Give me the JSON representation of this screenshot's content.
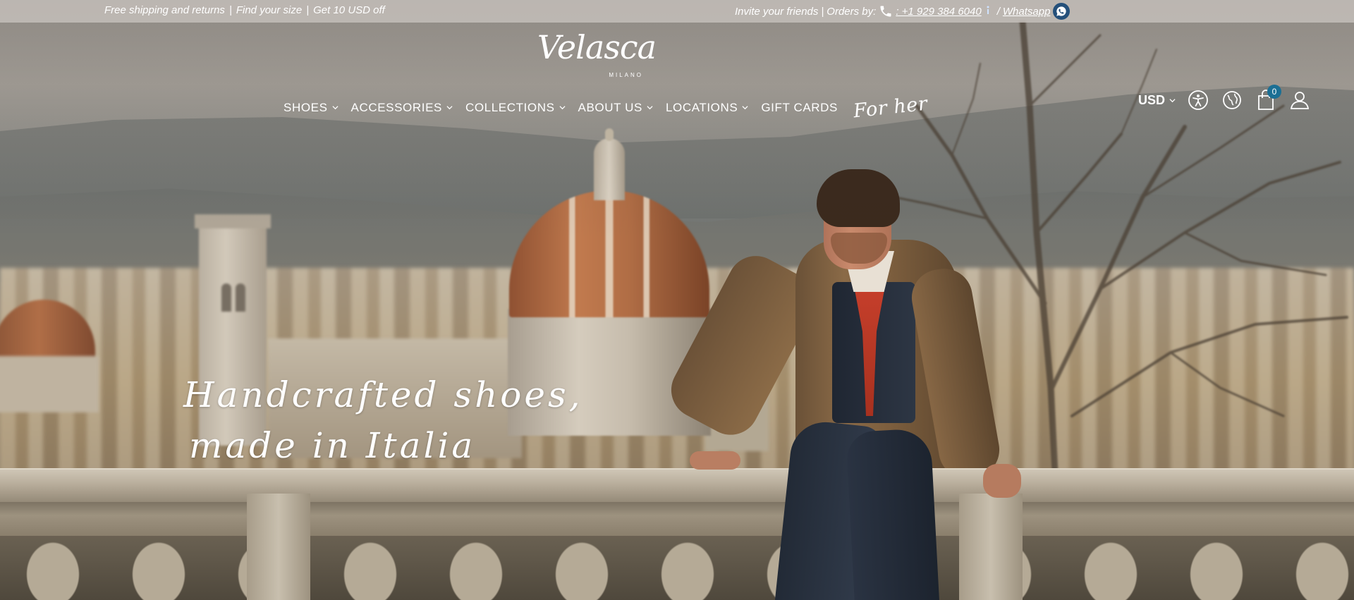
{
  "topbar": {
    "left": [
      {
        "label": "Free shipping and returns"
      },
      {
        "label": "Find your size"
      },
      {
        "label": "Get 10 USD off"
      }
    ],
    "invite": "Invite your friends",
    "orders_label": "Orders by:",
    "phone": ": +1 929 384 6040",
    "whatsapp": "Whatsapp",
    "separator": "|",
    "slash": "/"
  },
  "logo": {
    "script": "Velasca",
    "sub": "MILANO"
  },
  "nav": {
    "items": [
      {
        "label": "SHOES"
      },
      {
        "label": "ACCESSORIES"
      },
      {
        "label": "COLLECTIONS"
      },
      {
        "label": "ABOUT US"
      },
      {
        "label": "LOCATIONS"
      },
      {
        "label": "GIFT CARDS"
      }
    ],
    "for_her": "For her"
  },
  "header_tools": {
    "currency": "USD",
    "cart_count": "0",
    "icons": [
      "accessibility-icon",
      "globe-icon",
      "cart-icon",
      "user-icon"
    ]
  },
  "hero": {
    "line1": "Handcrafted shoes,",
    "line2": "made in Italia"
  },
  "colors": {
    "topbar_bg": "#c8c3be",
    "accent_badge": "#1b6f94",
    "whatsapp_bg": "#25507a"
  }
}
